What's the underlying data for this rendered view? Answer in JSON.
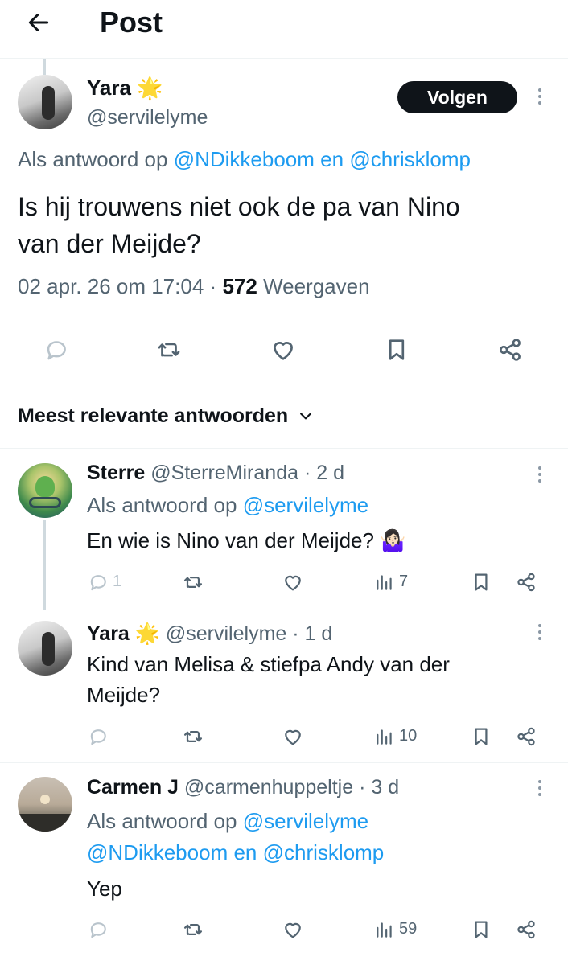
{
  "header": {
    "title": "Post"
  },
  "main_post": {
    "author_name": "Yara",
    "author_emoji": "🌟",
    "handle": "@servilelyme",
    "follow_label": "Volgen",
    "reply_prefix": "Als antwoord op",
    "reply_mention_1": "@NDikkeboom",
    "reply_and": "en",
    "reply_mention_2": "@chrisklomp",
    "text_line1": "Is hij trouwens niet ook de pa van Nino",
    "text_line2": "van der Meijde?",
    "timestamp": "02 apr. 26 om 17:04",
    "dot": "·",
    "views_count": "572",
    "views_label": "Weergaven"
  },
  "sort": {
    "label": "Meest relevante antwoorden"
  },
  "replies": [
    {
      "name": "Sterre",
      "handle": "@SterreMiranda",
      "age": "· 2 d",
      "reply_prefix": "Als antwoord op",
      "reply_mention": "@servilelyme",
      "text": "En wie is Nino van der Meijde? 🤷🏻‍♀️",
      "reply_count": "1",
      "views": "7"
    },
    {
      "name": "Yara",
      "emoji": "🌟",
      "handle": "@servilelyme",
      "age": "· 1 d",
      "text_line1": "Kind van Melisa & stiefpa Andy van der",
      "text_line2": "Meijde?",
      "views": "10"
    },
    {
      "name": "Carmen J",
      "handle": "@carmenhuppeltje",
      "age": "· 3 d",
      "reply_prefix": "Als antwoord op",
      "reply_mention_1": "@servilelyme",
      "reply_mention_2": "@NDikkeboom",
      "reply_and": "en",
      "reply_mention_3": "@chrisklomp",
      "text": "Yep",
      "views": "59"
    }
  ],
  "colors": {
    "link": "#1d9bf0",
    "muted": "#536471",
    "text": "#0f1419",
    "follow_bg": "#0f1419"
  }
}
